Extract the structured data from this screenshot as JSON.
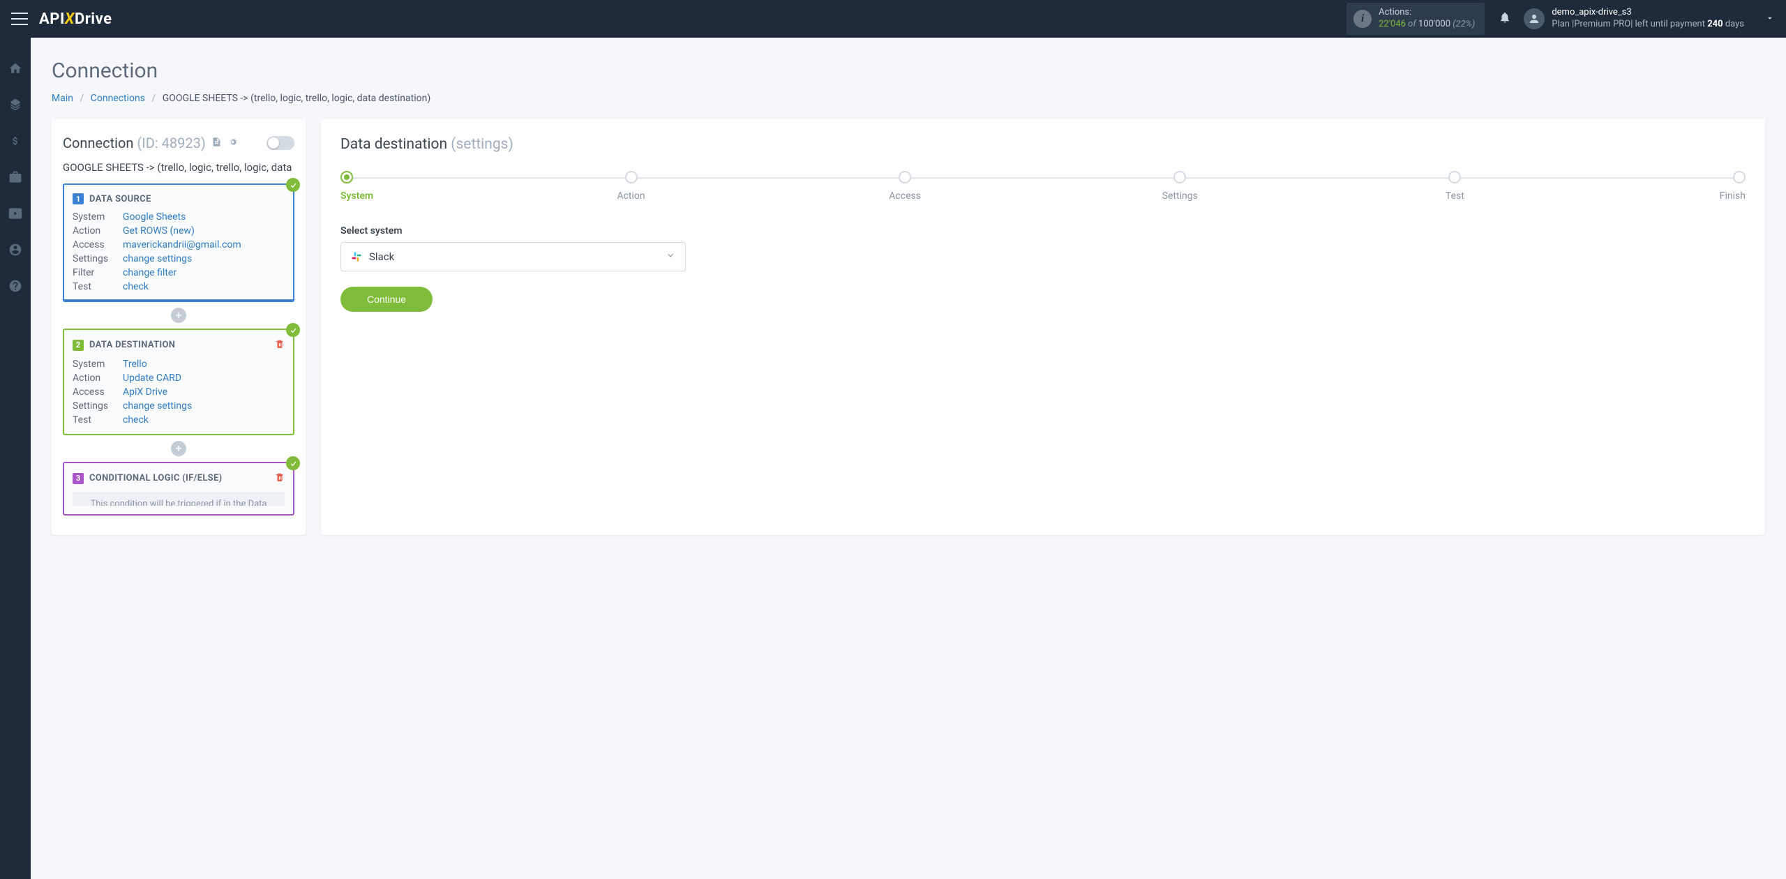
{
  "header": {
    "logo": {
      "api": "API",
      "x": "X",
      "drive": "Drive"
    },
    "actions": {
      "label": "Actions:",
      "count": "22'046",
      "of": " of ",
      "total": "100'000",
      "pct": " (22%)"
    },
    "user": {
      "name": "demo_apix-drive_s3",
      "plan_prefix": "Plan |Premium PRO| left until payment ",
      "plan_days": "240",
      "plan_suffix": " days"
    }
  },
  "page": {
    "title": "Connection",
    "breadcrumb": {
      "main": "Main",
      "connections": "Connections",
      "current": "GOOGLE SHEETS -> (trello, logic, trello, logic, data destination)"
    }
  },
  "left": {
    "title": "Connection ",
    "id": "(ID: 48923)",
    "conn_name": "GOOGLE SHEETS -> (trello, logic, trello, logic, data destination)",
    "block1": {
      "num": "1",
      "title": "DATA SOURCE",
      "rows": {
        "system": {
          "label": "System",
          "value": "Google Sheets"
        },
        "action": {
          "label": "Action",
          "value": "Get ROWS (new)"
        },
        "access": {
          "label": "Access",
          "value": "maverickandrii@gmail.com"
        },
        "settings": {
          "label": "Settings",
          "value": "change settings"
        },
        "filter": {
          "label": "Filter",
          "value": "change filter"
        },
        "test": {
          "label": "Test",
          "value": "check"
        }
      }
    },
    "block2": {
      "num": "2",
      "title": "DATA DESTINATION",
      "rows": {
        "system": {
          "label": "System",
          "value": "Trello"
        },
        "action": {
          "label": "Action",
          "value": "Update CARD"
        },
        "access": {
          "label": "Access",
          "value": "ApiX Drive"
        },
        "settings": {
          "label": "Settings",
          "value": "change settings"
        },
        "test": {
          "label": "Test",
          "value": "check"
        }
      }
    },
    "block3": {
      "num": "3",
      "title": "CONDITIONAL LOGIC (IF/ELSE)",
      "note": "This condition will be triggered if in the Data"
    }
  },
  "right": {
    "title": "Data destination ",
    "subtitle": "(settings)",
    "wizard": [
      "System",
      "Action",
      "Access",
      "Settings",
      "Test",
      "Finish"
    ],
    "select_label": "Select system",
    "select_value": "Slack",
    "continue": "Continue"
  }
}
